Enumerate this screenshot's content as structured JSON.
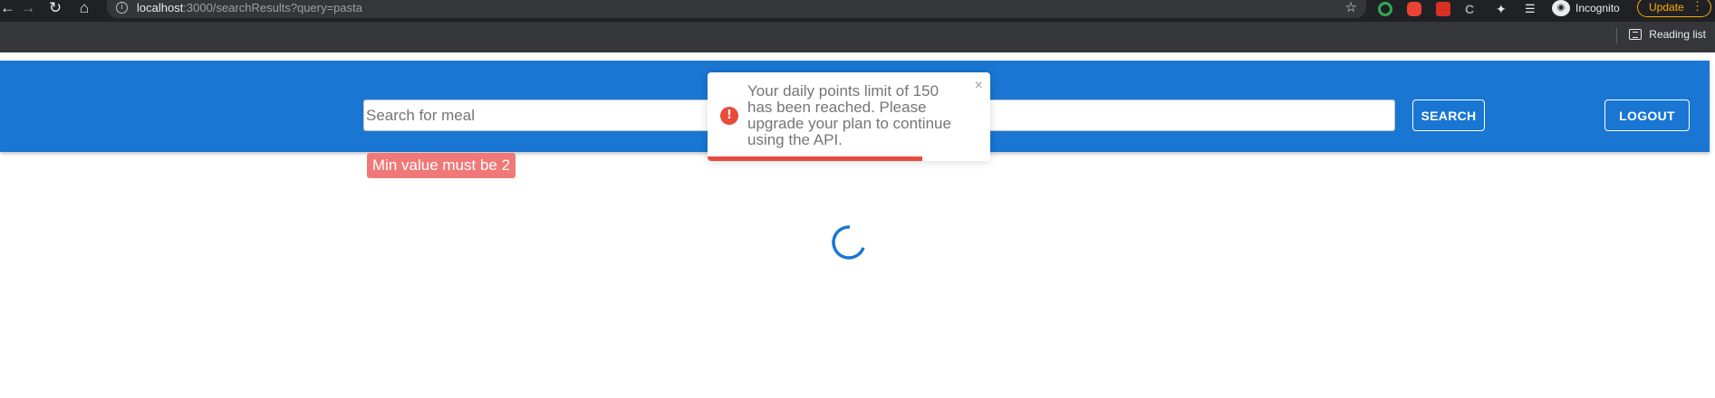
{
  "browser": {
    "url_host": "localhost",
    "url_rest": ":3000/searchResults?query=pasta",
    "profile_label": "Incognito",
    "update_label": "Update",
    "bookmarks_bar": {
      "reading_list_label": "Reading list"
    },
    "icons": [
      "back-arrow-icon",
      "forward-arrow-icon",
      "reload-icon",
      "home-icon",
      "info-icon",
      "star-icon",
      "extension-icon",
      "puzzle-icon",
      "media-control-icon",
      "incognito-icon",
      "menu-dots-icon",
      "reading-list-icon"
    ]
  },
  "header": {
    "search": {
      "placeholder": "Search for meal",
      "value": ""
    },
    "search_button": "SEARCH",
    "logout_button": "LOGOUT",
    "color": "#1976d2"
  },
  "validation": {
    "message": "Min value must be 2",
    "color": "#f07878"
  },
  "toast": {
    "message": "Your daily points limit of 150 has been reached. Please upgrade your plan to continue using the API.",
    "type": "error",
    "icon": "!",
    "close": "×",
    "progress": 0.76,
    "color": "#e74c3c"
  },
  "loading": {
    "spinner_color": "#1976d2"
  }
}
